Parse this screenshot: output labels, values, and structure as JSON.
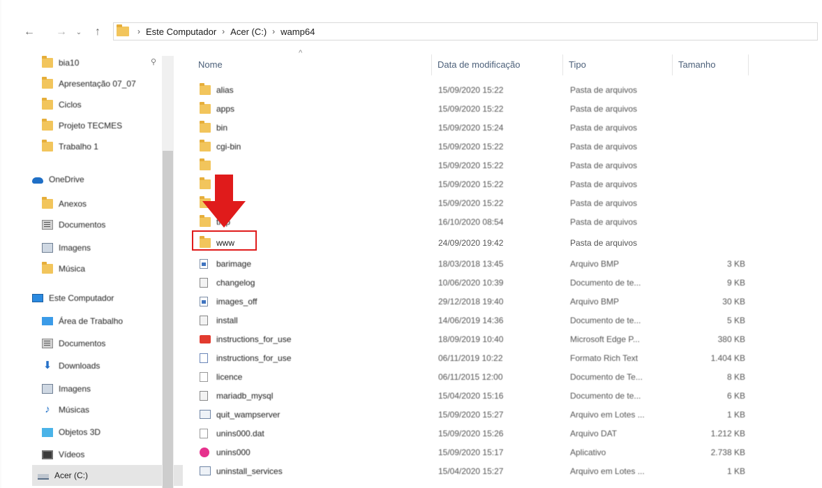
{
  "nav": {
    "back": "←",
    "forward": "→",
    "recent": "⌄",
    "up": "↑"
  },
  "breadcrumb": {
    "items": [
      "Este Computador",
      "Acer (C:)",
      "wamp64"
    ],
    "separator": "›"
  },
  "sidebar": {
    "items": [
      {
        "label": "bia10",
        "icon": "folder-icon"
      },
      {
        "label": "Apresentação 07_07",
        "icon": "folder-icon"
      },
      {
        "label": "Ciclos",
        "icon": "folder-icon"
      },
      {
        "label": "Projeto TECMES",
        "icon": "folder-icon"
      },
      {
        "label": "Trabalho 1",
        "icon": "folder-icon"
      },
      {
        "label": "OneDrive",
        "icon": "cloud-icon"
      },
      {
        "label": "Anexos",
        "icon": "folder-icon"
      },
      {
        "label": "Documentos",
        "icon": "documents-icon"
      },
      {
        "label": "Imagens",
        "icon": "images-icon"
      },
      {
        "label": "Música",
        "icon": "folder-icon"
      },
      {
        "label": "Este Computador",
        "icon": "computer-icon"
      },
      {
        "label": "Área de Trabalho",
        "icon": "desktop-icon"
      },
      {
        "label": "Documentos",
        "icon": "documents-icon"
      },
      {
        "label": "Downloads",
        "icon": "download-icon"
      },
      {
        "label": "Imagens",
        "icon": "images-icon"
      },
      {
        "label": "Músicas",
        "icon": "music-icon"
      },
      {
        "label": "Objetos 3D",
        "icon": "objects-3d-icon"
      },
      {
        "label": "Vídeos",
        "icon": "videos-icon"
      },
      {
        "label": "Acer (C:)",
        "icon": "drive-icon"
      }
    ],
    "pin_glyph": "⚲",
    "scroll_up_glyph": "^"
  },
  "columns": {
    "name": "Nome",
    "date": "Data de modificação",
    "type": "Tipo",
    "size": "Tamanho",
    "sort_caret": "^"
  },
  "files": [
    {
      "name": "alias",
      "date": "15/09/2020 15:22",
      "type": "Pasta de arquivos",
      "size": "",
      "icon": "folder-icon"
    },
    {
      "name": "apps",
      "date": "15/09/2020 15:22",
      "type": "Pasta de arquivos",
      "size": "",
      "icon": "folder-icon"
    },
    {
      "name": "bin",
      "date": "15/09/2020 15:24",
      "type": "Pasta de arquivos",
      "size": "",
      "icon": "folder-icon"
    },
    {
      "name": "cgi-bin",
      "date": "15/09/2020 15:22",
      "type": "Pasta de arquivos",
      "size": "",
      "icon": "folder-icon"
    },
    {
      "name": "",
      "date": "15/09/2020 15:22",
      "type": "Pasta de arquivos",
      "size": "",
      "icon": "folder-icon"
    },
    {
      "name": "",
      "date": "15/09/2020 15:22",
      "type": "Pasta de arquivos",
      "size": "",
      "icon": "folder-icon"
    },
    {
      "name": "",
      "date": "15/09/2020 15:22",
      "type": "Pasta de arquivos",
      "size": "",
      "icon": "folder-icon"
    },
    {
      "name": "tmp",
      "date": "16/10/2020 08:54",
      "type": "Pasta de arquivos",
      "size": "",
      "icon": "folder-icon"
    },
    {
      "name": "www",
      "date": "24/09/2020 19:42",
      "type": "Pasta de arquivos",
      "size": "",
      "icon": "folder-icon"
    },
    {
      "name": "barimage",
      "date": "18/03/2018 13:45",
      "type": "Arquivo BMP",
      "size": "3 KB",
      "icon": "bmp-file-icon"
    },
    {
      "name": "changelog",
      "date": "10/06/2020 10:39",
      "type": "Documento de te...",
      "size": "9 KB",
      "icon": "document-icon"
    },
    {
      "name": "images_off",
      "date": "29/12/2018 19:40",
      "type": "Arquivo BMP",
      "size": "30 KB",
      "icon": "bmp-file-icon"
    },
    {
      "name": "install",
      "date": "14/06/2019 14:36",
      "type": "Documento de te...",
      "size": "5 KB",
      "icon": "document-icon"
    },
    {
      "name": "instructions_for_use",
      "date": "18/09/2019 10:40",
      "type": "Microsoft Edge P...",
      "size": "380 KB",
      "icon": "edge-pdf-icon"
    },
    {
      "name": "instructions_for_use",
      "date": "06/11/2019 10:22",
      "type": "Formato Rich Text",
      "size": "1.404 KB",
      "icon": "rtf-file-icon"
    },
    {
      "name": "licence",
      "date": "06/11/2015 12:00",
      "type": "Documento de Te...",
      "size": "8 KB",
      "icon": "text-file-icon"
    },
    {
      "name": "mariadb_mysql",
      "date": "15/04/2020 15:16",
      "type": "Documento de te...",
      "size": "6 KB",
      "icon": "document-icon"
    },
    {
      "name": "quit_wampserver",
      "date": "15/09/2020 15:27",
      "type": "Arquivo em Lotes ...",
      "size": "1 KB",
      "icon": "batch-file-icon"
    },
    {
      "name": "unins000.dat",
      "date": "15/09/2020 15:26",
      "type": "Arquivo DAT",
      "size": "1.212 KB",
      "icon": "text-file-icon"
    },
    {
      "name": "unins000",
      "date": "15/09/2020 15:17",
      "type": "Aplicativo",
      "size": "2.738 KB",
      "icon": "application-icon"
    },
    {
      "name": "uninstall_services",
      "date": "15/04/2020 15:27",
      "type": "Arquivo em Lotes ...",
      "size": "1 KB",
      "icon": "batch-file-icon"
    }
  ],
  "annotation": {
    "color": "#e01b1b",
    "highlighted_item": "www"
  },
  "colors": {
    "folder": "#f2c55c",
    "header_text": "#4c607a",
    "selected_bg": "#e5e5e5"
  }
}
